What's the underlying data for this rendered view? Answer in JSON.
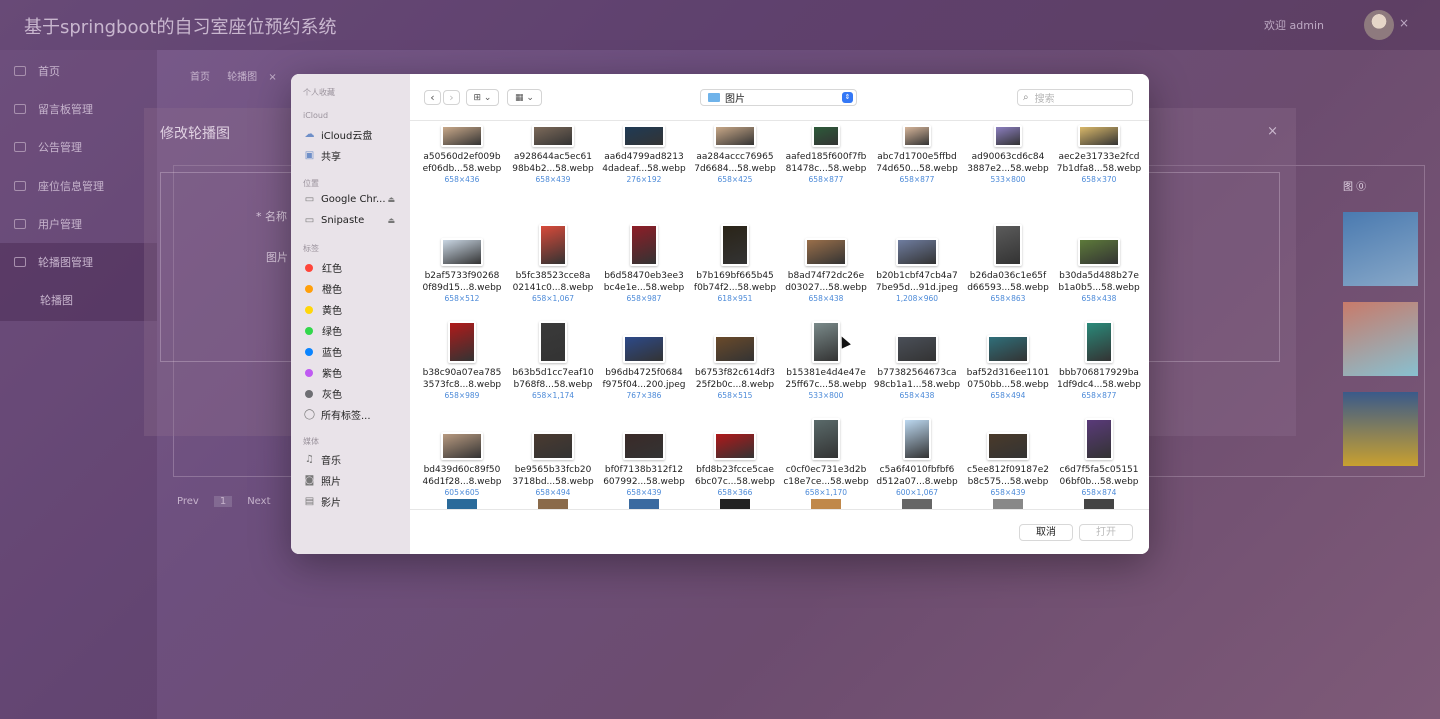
{
  "app": {
    "title": "基于springboot的自习室座位预约系统",
    "welcome": "欢迎 admin",
    "close_glyph": "×"
  },
  "sidebar": {
    "items": [
      {
        "label": "首页"
      },
      {
        "label": "留言板管理"
      },
      {
        "label": "公告管理"
      },
      {
        "label": "座位信息管理"
      },
      {
        "label": "用户管理"
      },
      {
        "label": "轮播图管理"
      }
    ],
    "sub_item": "轮播图"
  },
  "breadcrumb": {
    "a": "首页",
    "b": "轮播图",
    "close": "×"
  },
  "edit_panel": {
    "title": "修改轮播图",
    "close": "×",
    "name_label": "* 名称",
    "image_label": "图片"
  },
  "table": {
    "header": "图 ⓪"
  },
  "pager": {
    "prev": "Prev",
    "page": "1",
    "next": "Next"
  },
  "finder": {
    "sidebar": {
      "favorites_section": "个人收藏",
      "icloud_section": "iCloud",
      "icloud_drive": "iCloud云盘",
      "shared": "共享",
      "locations_section": "位置",
      "loc1": "Google Chr...",
      "loc2": "Snipaste",
      "tags_section": "标签",
      "tags": [
        {
          "label": "红色",
          "color": "#ff453a"
        },
        {
          "label": "橙色",
          "color": "#ff9f0a"
        },
        {
          "label": "黄色",
          "color": "#ffd60a"
        },
        {
          "label": "绿色",
          "color": "#32d74b"
        },
        {
          "label": "蓝色",
          "color": "#0a84ff"
        },
        {
          "label": "紫色",
          "color": "#bf5af2"
        },
        {
          "label": "灰色",
          "color": "#6e6e73"
        }
      ],
      "all_tags": "所有标签...",
      "media_section": "媒体",
      "music": "音乐",
      "photos": "照片",
      "movies": "影片"
    },
    "toolbar": {
      "back": "‹",
      "forward": "›",
      "grid_view": "⊞ ⌄",
      "group_view": "▦ ⌄",
      "path": "图片",
      "search_placeholder": "搜索"
    },
    "files": [
      {
        "l1": "a50560d2ef009b",
        "l2": "ef06db...58.webp",
        "dim": "658×436",
        "color": "#c9a98a"
      },
      {
        "l1": "a928644ac5ec61",
        "l2": "98b4b2...58.webp",
        "dim": "658×439",
        "color": "#7d6a5a"
      },
      {
        "l1": "aa6d4799ad8213",
        "l2": "4dadeaf...58.webp",
        "dim": "276×192",
        "color": "#1f3b56"
      },
      {
        "l1": "aa284accc76965",
        "l2": "7d6684...58.webp",
        "dim": "658×425",
        "color": "#c8a888"
      },
      {
        "l1": "aafed185f600f7fb",
        "l2": "81478c...58.webp",
        "dim": "658×877",
        "color": "#2d5b3a"
      },
      {
        "l1": "abc7d1700e5ffbd",
        "l2": "74d650...58.webp",
        "dim": "658×877",
        "color": "#d6b59a"
      },
      {
        "l1": "ad90063cd6c84",
        "l2": "3887e2...58.webp",
        "dim": "533×800",
        "color": "#8c7fc0"
      },
      {
        "l1": "aec2e31733e2fcd",
        "l2": "7b1dfa8...58.webp",
        "dim": "658×370",
        "color": "#d9b86a"
      },
      {
        "l1": "b2af5733f90268",
        "l2": "0f89d15...8.webp",
        "dim": "658×512",
        "color": "#c9d6e3"
      },
      {
        "l1": "b5fc38523cce8a",
        "l2": "02141c0...8.webp",
        "dim": "658×1,067",
        "color": "#d84a3a"
      },
      {
        "l1": "b6d58470eb3ee3",
        "l2": "bc4e1e...58.webp",
        "dim": "658×987",
        "color": "#8e1d27"
      },
      {
        "l1": "b7b169bf665b45",
        "l2": "f0b74f2...58.webp",
        "dim": "618×951",
        "color": "#2a2418"
      },
      {
        "l1": "b8ad74f72dc26e",
        "l2": "d03027...58.webp",
        "dim": "658×438",
        "color": "#9a6f4a"
      },
      {
        "l1": "b20b1cbf47cb4a7",
        "l2": "7be95d...91d.jpeg",
        "dim": "1,208×960",
        "color": "#6f7da0"
      },
      {
        "l1": "b26da036c1e65f",
        "l2": "d66593...58.webp",
        "dim": "658×863",
        "color": "#5b5b5b"
      },
      {
        "l1": "b30da5d488b27e",
        "l2": "b1a0b5...58.webp",
        "dim": "658×438",
        "color": "#5d7a3a"
      },
      {
        "l1": "b38c90a07ea785",
        "l2": "3573fc8...8.webp",
        "dim": "658×989",
        "color": "#b01a1a"
      },
      {
        "l1": "b63b5d1cc7eaf10",
        "l2": "b768f8...58.webp",
        "dim": "658×1,174",
        "color": "#3a3a3a"
      },
      {
        "l1": "b96db4725f0684",
        "l2": "f975f04...200.jpeg",
        "dim": "767×386",
        "color": "#2d4a8a"
      },
      {
        "l1": "b6753f82c614df3",
        "l2": "25f2b0c...8.webp",
        "dim": "658×515",
        "color": "#6a4a2a"
      },
      {
        "l1": "b15381e4d4e47e",
        "l2": "25ff67c...58.webp",
        "dim": "533×800",
        "color": "#7a8a8a"
      },
      {
        "l1": "b77382564673ca",
        "l2": "98cb1a1...58.webp",
        "dim": "658×438",
        "color": "#4a4f58"
      },
      {
        "l1": "baf52d316ee1101",
        "l2": "0750bb...58.webp",
        "dim": "658×494",
        "color": "#2f6f7a"
      },
      {
        "l1": "bbb706817929ba",
        "l2": "1df9dc4...58.webp",
        "dim": "658×877",
        "color": "#2a8a7a"
      },
      {
        "l1": "bd439d60c89f50",
        "l2": "46d1f28...8.webp",
        "dim": "605×605",
        "color": "#b89a80"
      },
      {
        "l1": "be9565b33fcb20",
        "l2": "3718bd...58.webp",
        "dim": "658×494",
        "color": "#4a3a30"
      },
      {
        "l1": "bf0f7138b312f12",
        "l2": "607992...58.webp",
        "dim": "658×439",
        "color": "#3a2a28"
      },
      {
        "l1": "bfd8b23fcce5cae",
        "l2": "6bc07c...58.webp",
        "dim": "658×366",
        "color": "#b0181a"
      },
      {
        "l1": "c0cf0ec731e3d2b",
        "l2": "c18e7ce...58.webp",
        "dim": "658×1,170",
        "color": "#5a6a6a"
      },
      {
        "l1": "c5a6f4010fbfbf6",
        "l2": "d512a07...8.webp",
        "dim": "600×1,067",
        "color": "#bcd8f0"
      },
      {
        "l1": "c5ee812f09187e2",
        "l2": "b8c575...58.webp",
        "dim": "658×439",
        "color": "#4a3a2a"
      },
      {
        "l1": "c6d7f5fa5c05151",
        "l2": "06bf0b...58.webp",
        "dim": "658×874",
        "color": "#5a3a7a"
      }
    ],
    "footer": {
      "cancel": "取消",
      "open": "打开"
    }
  }
}
